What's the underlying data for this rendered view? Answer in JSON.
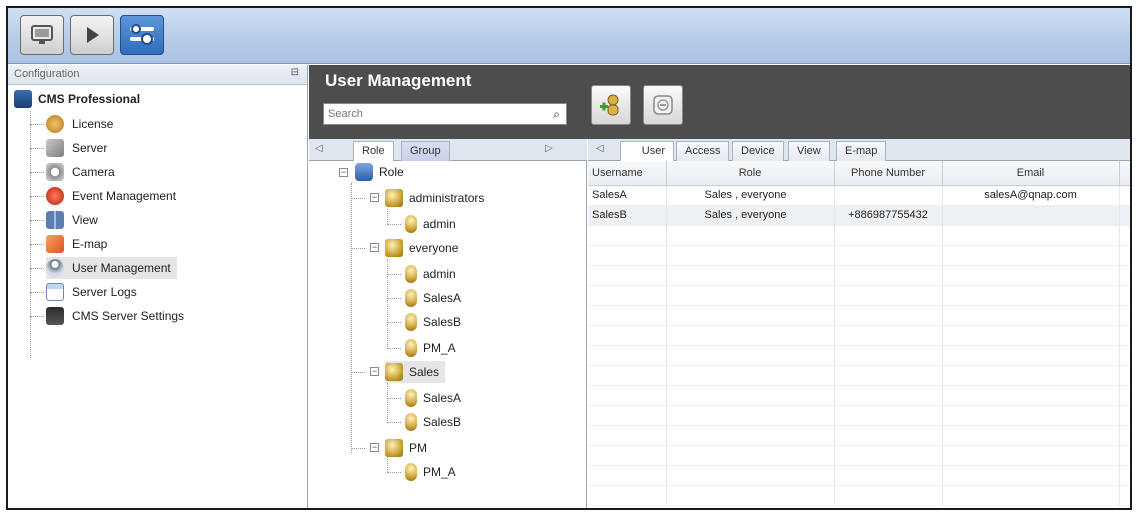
{
  "toolbar": {
    "buttons": [
      {
        "name": "monitor-button",
        "icon": "monitor-icon"
      },
      {
        "name": "playback-button",
        "icon": "play-icon"
      },
      {
        "name": "configuration-button",
        "icon": "tools-icon",
        "active": true
      }
    ]
  },
  "left_panel": {
    "header": "Configuration",
    "pin": "ᵖ",
    "root_label": "CMS Professional",
    "items": [
      {
        "label": "License",
        "icon": "license-icon"
      },
      {
        "label": "Server",
        "icon": "server-icon"
      },
      {
        "label": "Camera",
        "icon": "camera-icon"
      },
      {
        "label": "Event Management",
        "icon": "event-icon"
      },
      {
        "label": "View",
        "icon": "view-icon"
      },
      {
        "label": "E-map",
        "icon": "emap-icon"
      },
      {
        "label": "User Management",
        "icon": "users-icon",
        "selected": true
      },
      {
        "label": "Server Logs",
        "icon": "logs-icon"
      },
      {
        "label": "CMS Server Settings",
        "icon": "settings-icon"
      }
    ]
  },
  "header": {
    "title": "User Management",
    "search_placeholder": "Search"
  },
  "role_tabs": {
    "tabs": [
      "Role",
      "Group"
    ],
    "active": "Role"
  },
  "user_tabs": {
    "tabs": [
      "User",
      "Access",
      "Device",
      "View",
      "E-map"
    ],
    "active": "User"
  },
  "tree": {
    "root": "Role",
    "groups": [
      {
        "label": "administrators",
        "members": [
          "admin"
        ]
      },
      {
        "label": "everyone",
        "members": [
          "admin",
          "SalesA",
          "SalesB",
          "PM_A"
        ]
      },
      {
        "label": "Sales",
        "members": [
          "SalesA",
          "SalesB"
        ],
        "selected": true
      },
      {
        "label": "PM",
        "members": [
          "PM_A"
        ]
      }
    ]
  },
  "table": {
    "columns": [
      "Username",
      "Role",
      "Phone Number",
      "Email"
    ],
    "rows": [
      [
        "SalesA",
        "Sales , everyone",
        "",
        "salesA@qnap.com"
      ],
      [
        "SalesB",
        "Sales , everyone",
        "+886987755432",
        ""
      ]
    ]
  },
  "colors": {
    "title_bar": "#b7cde8",
    "header_dark": "#4d4d4d",
    "accent_blue": "#2f6dbb"
  }
}
